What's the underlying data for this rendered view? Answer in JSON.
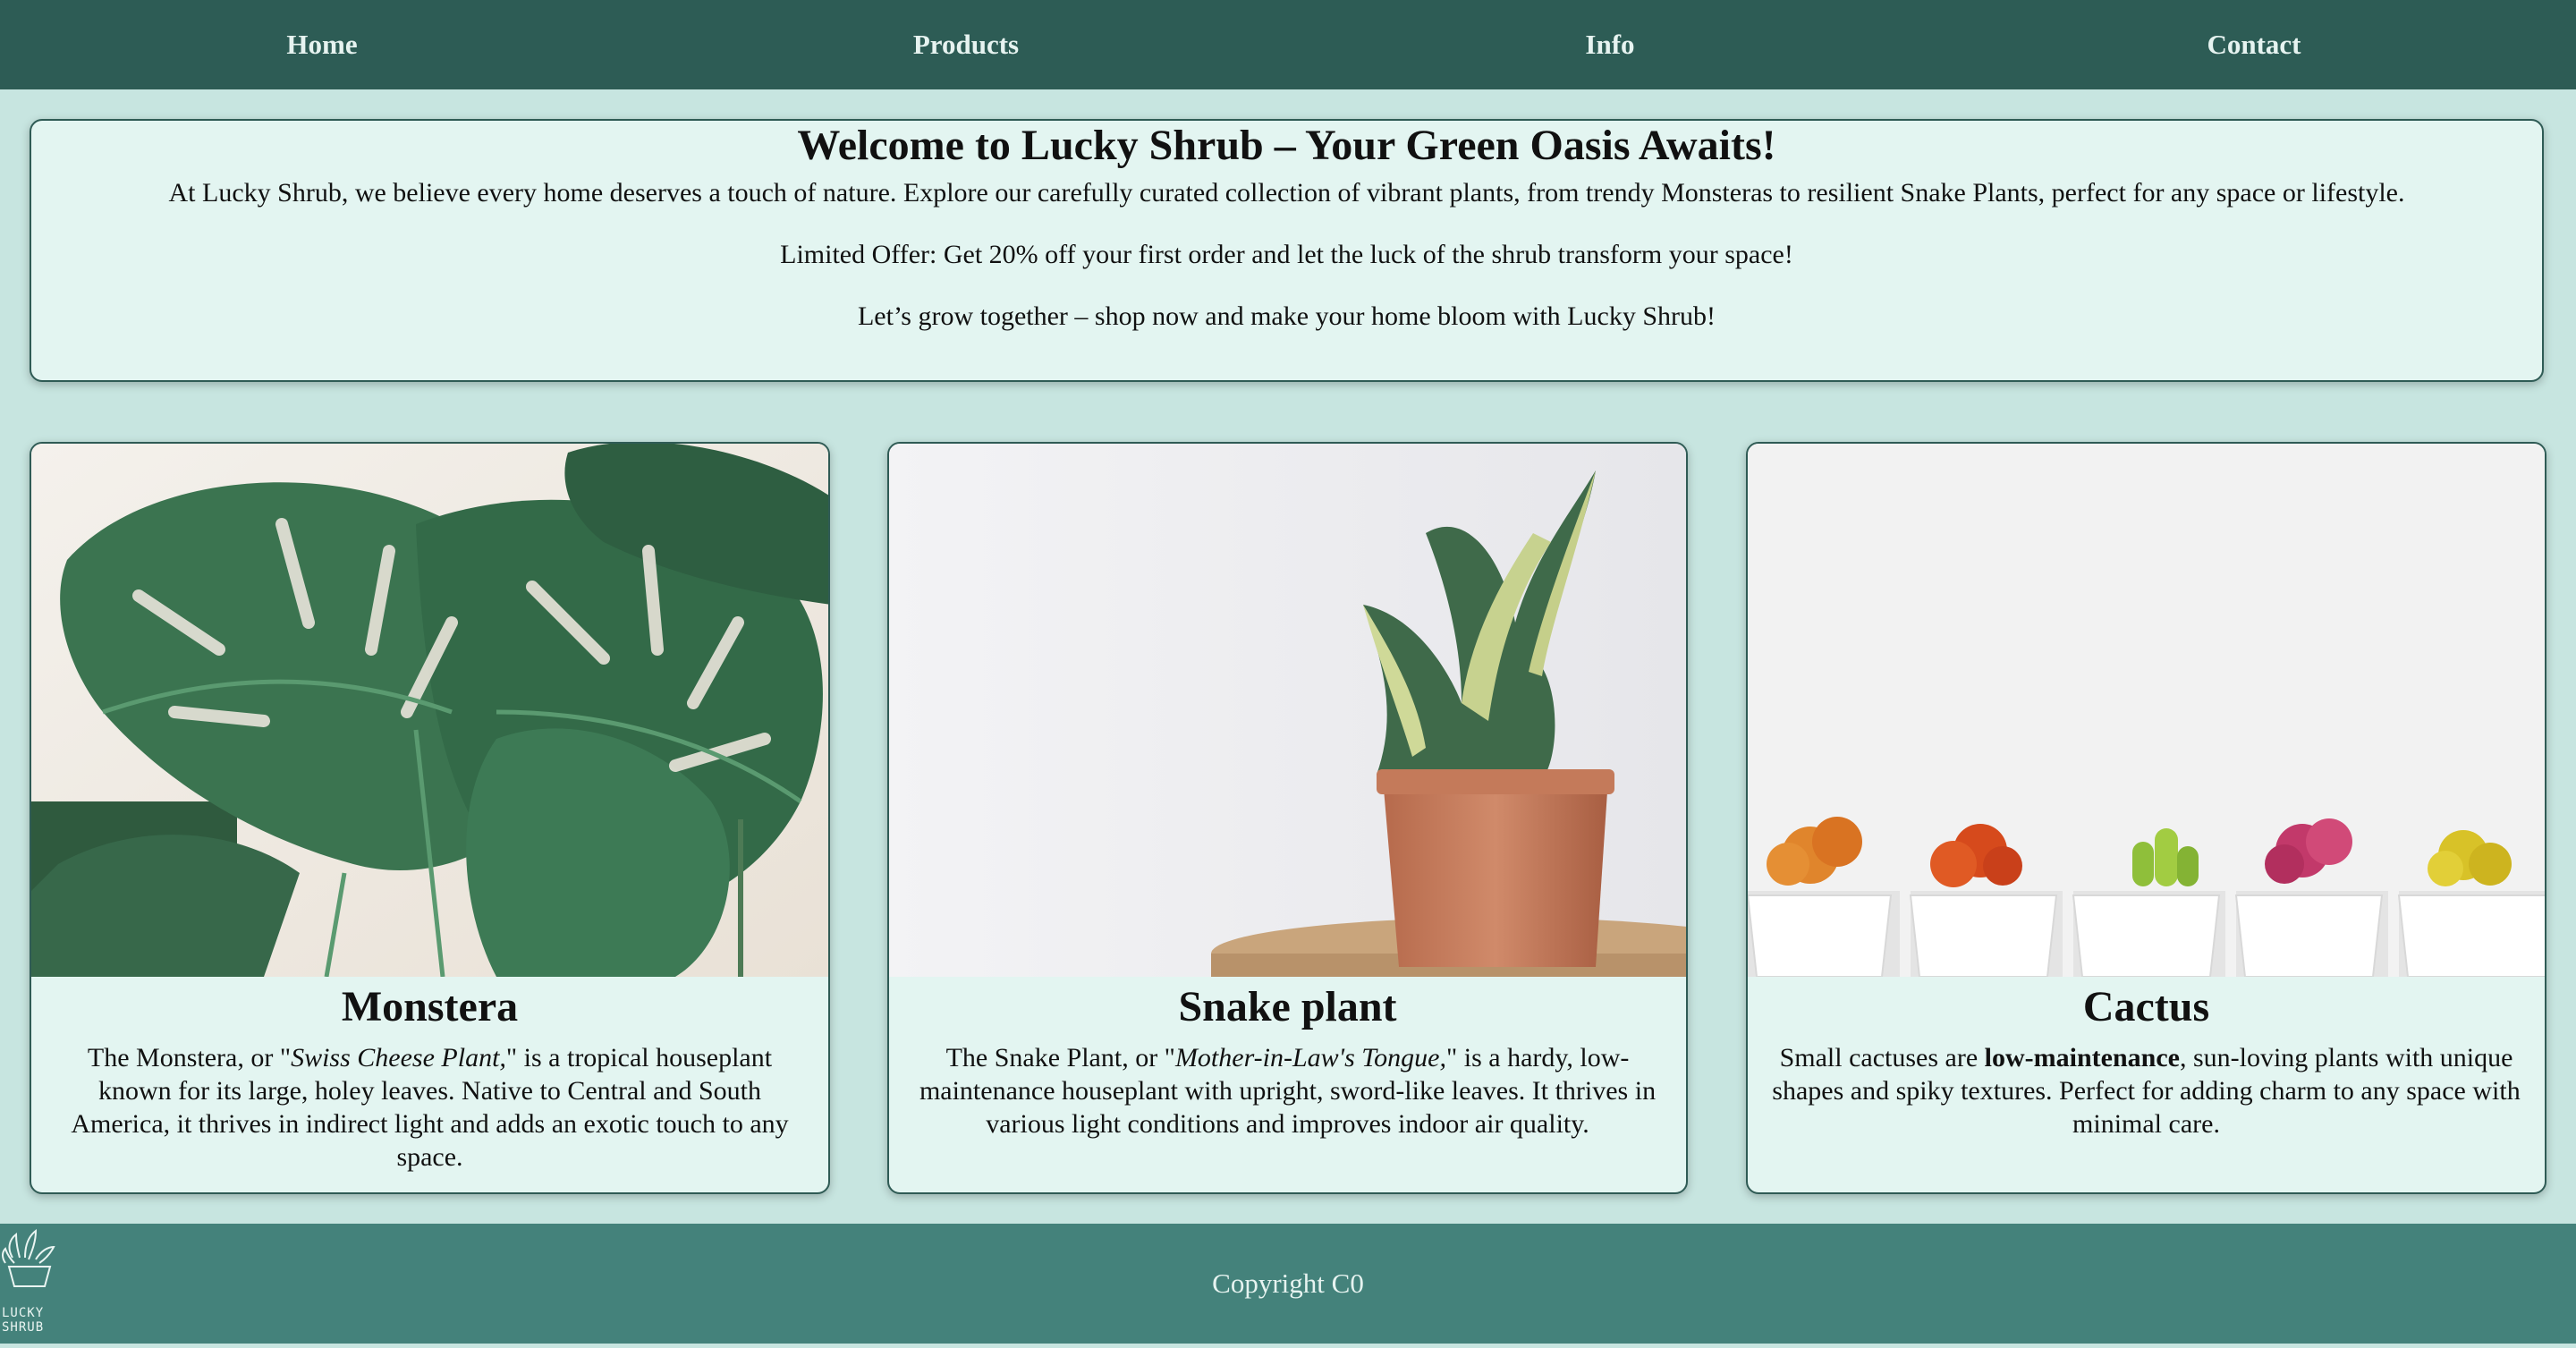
{
  "nav": {
    "items": [
      "Home",
      "Products",
      "Info",
      "Contact"
    ]
  },
  "hero": {
    "title": "Welcome to Lucky Shrub – Your Green Oasis Awaits!",
    "p1": "At Lucky Shrub, we believe every home deserves a touch of nature. Explore our carefully curated collection of vibrant plants, from trendy Monsteras to resilient Snake Plants, perfect for any space or lifestyle.",
    "p2": "Limited Offer: Get 20% off your first order and let the luck of the shrub transform your space!",
    "p3": "Let’s grow together – shop now and make your home bloom with Lucky Shrub!"
  },
  "cards": [
    {
      "title": "Monstera",
      "text_a": "The Monstera, or \"",
      "text_em": "Swiss Cheese Plant,",
      "text_b": "\" is a tropical houseplant known for its large, holey leaves. Native to Central and South America, it thrives in indirect light and adds an exotic touch to any space."
    },
    {
      "title": "Snake plant",
      "text_a": "The Snake Plant, or \"",
      "text_em": "Mother-in-Law's Tongue,",
      "text_b": "\" is a hardy, low-maintenance houseplant with upright, sword-like leaves. It thrives in various light conditions and improves indoor air quality."
    },
    {
      "title": "Cactus",
      "text_a": "Small cactuses are ",
      "text_strong": "low-maintenance",
      "text_b": ", sun-loving plants with unique shapes and spiky textures. Perfect for adding charm to any space with minimal care."
    }
  ],
  "footer": {
    "copyright": "Copyright C0",
    "logo_text": [
      "LUCKY",
      "SHRUB"
    ]
  },
  "colors": {
    "nav": "#2d5c55",
    "footer": "#44827b",
    "page": "#c7e5e0",
    "panel": "#e3f5f1"
  }
}
